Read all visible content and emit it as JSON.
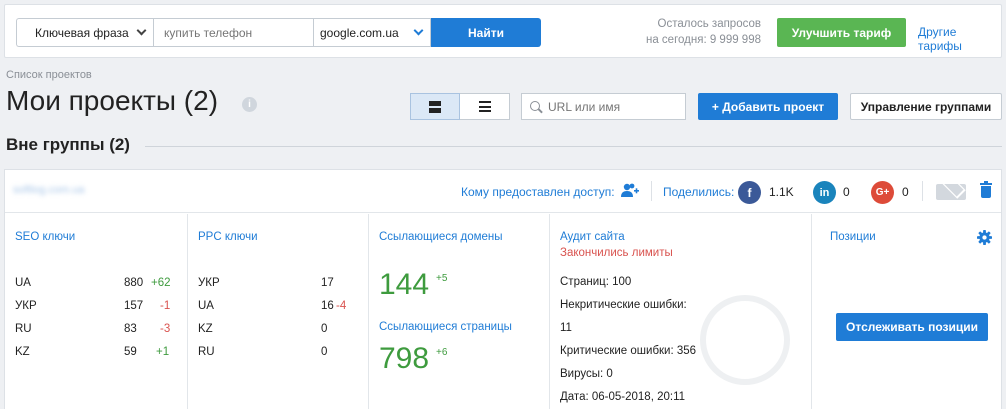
{
  "topbar": {
    "mode_select": "Ключевая фраза",
    "query_placeholder": "купить телефон",
    "engine_select": "google.com.ua",
    "find_button": "Найти",
    "remaining_line1": "Осталось запросов",
    "remaining_line2": "на сегодня: 9 999 998",
    "upgrade_button": "Улучшить тариф",
    "other_plans_link": "Другие тарифы"
  },
  "header": {
    "breadcrumb": "Список проектов",
    "title": "Мои проекты (2)",
    "url_search_placeholder": "URL или имя",
    "add_project_button": "+ Добавить проект",
    "manage_groups_button": "Управление группами"
  },
  "group": {
    "title": "Вне группы (2)"
  },
  "project": {
    "domain": "softlog.com.ua",
    "access_label": "Кому предоставлен доступ:",
    "shared_label": "Поделились:",
    "social": [
      {
        "name": "facebook",
        "glyph": "f",
        "count": "1.1K",
        "color": "#3b5998"
      },
      {
        "name": "linkedin",
        "glyph": "in",
        "count": "0",
        "color": "#1a84bc"
      },
      {
        "name": "google-plus",
        "glyph": "G+",
        "count": "0",
        "color": "#dd4b39"
      }
    ],
    "seo": {
      "title": "SEO ключи",
      "rows": [
        {
          "region": "UA",
          "value": "880",
          "delta": "+62",
          "dir": "pos"
        },
        {
          "region": "УКР",
          "value": "157",
          "delta": "-1",
          "dir": "neg"
        },
        {
          "region": "RU",
          "value": "83",
          "delta": "-3",
          "dir": "neg"
        },
        {
          "region": "KZ",
          "value": "59",
          "delta": "+1",
          "dir": "pos"
        }
      ]
    },
    "ppc": {
      "title": "PPC ключи",
      "rows": [
        {
          "region": "УКР",
          "value": "17",
          "delta": "",
          "dir": ""
        },
        {
          "region": "UA",
          "value": "16",
          "delta": "-4",
          "dir": "neg"
        },
        {
          "region": "KZ",
          "value": "0",
          "delta": "",
          "dir": ""
        },
        {
          "region": "RU",
          "value": "0",
          "delta": "",
          "dir": ""
        }
      ]
    },
    "links": {
      "domains_title": "Ссылающиеся домены",
      "domains_value": "144",
      "domains_delta": "+5",
      "pages_title": "Ссылающиеся страницы",
      "pages_value": "798",
      "pages_delta": "+6"
    },
    "audit": {
      "title": "Аудит сайта",
      "limits_warning": "Закончились лимиты",
      "pages": "Страниц: 100",
      "noncritical_label": "Некритические ошибки:",
      "noncritical_value": "11",
      "critical": "Критические ошибки: 356",
      "viruses": "Вирусы: 0",
      "date_label": "Дата:",
      "date_value": "06-05-2018, 20:11"
    },
    "positions": {
      "title": "Позиции",
      "track_button": "Отслеживать позиции"
    }
  }
}
